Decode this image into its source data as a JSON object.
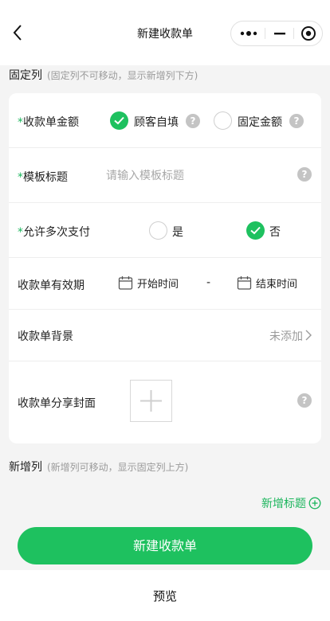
{
  "nav": {
    "title": "新建收款单"
  },
  "fixed_section": {
    "title": "固定列",
    "hint": "(固定列不可移动，显示新增列下方)"
  },
  "amount_row": {
    "required_mark": "*",
    "label": "收款单金额",
    "option_customer": "顾客自填",
    "option_customer_checked": true,
    "option_fixed": "固定金额",
    "option_fixed_checked": false
  },
  "template_row": {
    "required_mark": "*",
    "label": "模板标题",
    "value": "",
    "placeholder": "请输入模板标题"
  },
  "multi_pay_row": {
    "required_mark": "*",
    "label": "允许多次支付",
    "option_yes": "是",
    "option_yes_checked": false,
    "option_no": "否",
    "option_no_checked": true
  },
  "validity_row": {
    "label": "收款单有效期",
    "start_label": "开始时间",
    "separator": "-",
    "end_label": "结束时间"
  },
  "background_row": {
    "label": "收款单背景",
    "value": "未添加"
  },
  "cover_row": {
    "label": "收款单分享封面"
  },
  "new_section": {
    "title": "新增列",
    "hint": "(新增列可移动，显示固定列上方)"
  },
  "actions": {
    "add_title": "新增标题",
    "create_button": "新建收款单",
    "preview_button": "预览"
  },
  "colors": {
    "accent": "#1ec15f",
    "accent_text": "#1bb55c",
    "background": "#f4f4f4"
  }
}
